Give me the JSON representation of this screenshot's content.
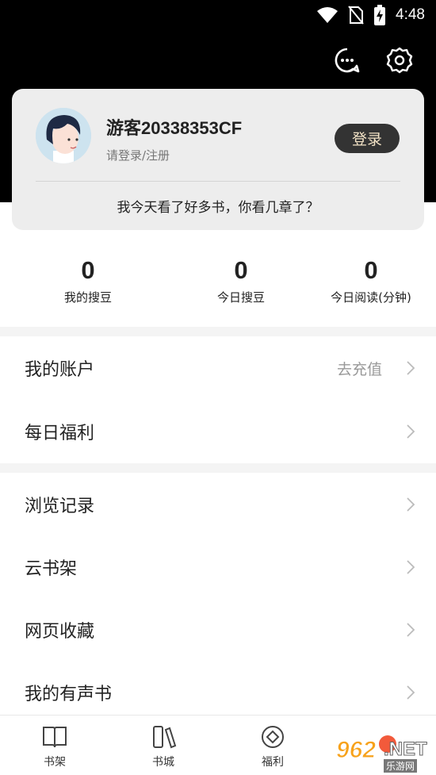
{
  "status_bar": {
    "time": "4:48"
  },
  "header": {
    "message_icon": "chat-bubble-icon",
    "settings_icon": "gear-icon"
  },
  "profile": {
    "username": "游客20338353CF",
    "subtitle": "请登录/注册",
    "login_label": "登录",
    "slogan": "我今天看了好多书，你看几章了？"
  },
  "stats": [
    {
      "value": "0",
      "label": "我的搜豆"
    },
    {
      "value": "0",
      "label": "今日搜豆"
    },
    {
      "value": "0",
      "label": "今日阅读(分钟)"
    }
  ],
  "menu": {
    "account": {
      "label": "我的账户",
      "extra": "去充值"
    },
    "daily": {
      "label": "每日福利"
    },
    "history": {
      "label": "浏览记录"
    },
    "cloud_shelf": {
      "label": "云书架"
    },
    "bookmarks": {
      "label": "网页收藏"
    },
    "audiobooks": {
      "label": "我的有声书"
    }
  },
  "tabs": [
    {
      "label": "书架",
      "icon": "open-book-icon"
    },
    {
      "label": "书城",
      "icon": "books-icon"
    },
    {
      "label": "福利",
      "icon": "coin-icon"
    }
  ],
  "watermark": {
    "number": "962",
    "suffix": ".NET",
    "sub": "乐游网"
  },
  "colors": {
    "hero_bg": "#000000",
    "card_bg": "#ededed",
    "login_bg": "#333333",
    "login_text": "#f3e3c6",
    "badge": "#f25a3b"
  }
}
